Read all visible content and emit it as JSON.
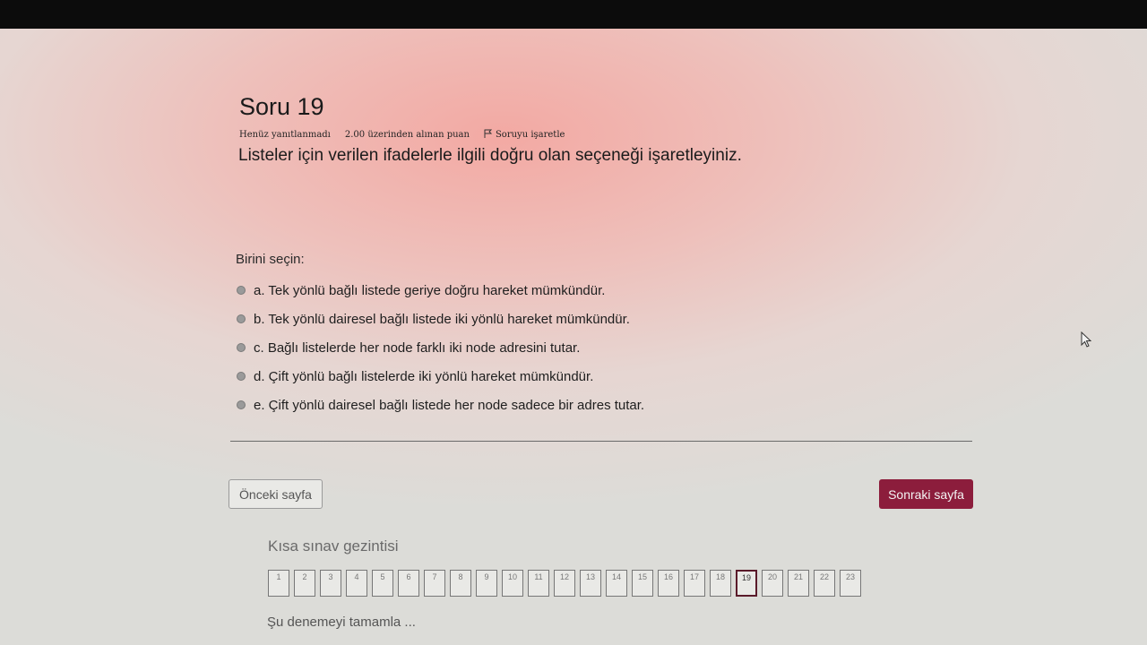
{
  "question": {
    "title": "Soru 19",
    "status": "Henüz yanıtlanmadı",
    "points": "2.00 üzerinden alınan puan",
    "flag_label": "Soruyu işaretle",
    "text": "Listeler için verilen ifadelerle ilgili doğru olan seçeneği işaretleyiniz.",
    "prompt": "Birini seçin:",
    "answers": [
      "a. Tek yönlü bağlı listede geriye doğru hareket mümkündür.",
      "b. Tek yönlü dairesel bağlı listede iki yönlü hareket mümkündür.",
      "c. Bağlı listelerde her node farklı iki node adresini tutar.",
      "d. Çift yönlü bağlı listelerde iki yönlü hareket mümkündür.",
      "e. Çift yönlü dairesel bağlı listede her node sadece bir adres tutar."
    ]
  },
  "buttons": {
    "prev": "Önceki sayfa",
    "next": "Sonraki sayfa"
  },
  "navigation": {
    "title": "Kısa sınav gezintisi",
    "pages": [
      "1",
      "2",
      "3",
      "4",
      "5",
      "6",
      "7",
      "8",
      "9",
      "10",
      "11",
      "12",
      "13",
      "14",
      "15",
      "16",
      "17",
      "18",
      "19",
      "20",
      "21",
      "22",
      "23"
    ],
    "current": "19",
    "finish_label": "Şu denemeyi tamamla ..."
  },
  "colors": {
    "next_button": "#8c1d3c",
    "current_page_border": "#5a1a2a"
  },
  "icons": {
    "flag": "flag-icon",
    "cursor": "mouse-pointer-icon"
  }
}
